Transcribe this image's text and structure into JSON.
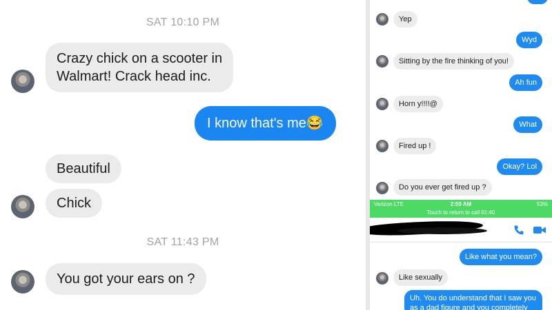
{
  "left": {
    "timestamps": [
      "SAT 10:10 PM",
      "SAT 11:43 PM"
    ],
    "messages": {
      "m1_line1": "Crazy chick on a scooter in",
      "m1_line2": "Walmart!  Crack head inc.",
      "m2": "I know that's me😂",
      "m3": "Beautiful",
      "m4": "Chick",
      "m5": "You got your ears on ?"
    }
  },
  "right": {
    "messages": {
      "yep": "Yep",
      "wyd": "Wyd",
      "sitting": "Sitting by the fire thinking of you!",
      "ahfun": "Ah fun",
      "horny": "Horn y!!!!@",
      "what": "What",
      "firedup": "Fired up !",
      "okay": "Okay? Lol",
      "everfired": "Do you ever get fired up ?",
      "likewhat": "Like what you mean?",
      "likesexually": "Like sexually",
      "understand": "Uh. You do understand that I saw you as a dad figure and you completely"
    },
    "status_bar": {
      "carrier": "Verizon  LTE",
      "time": "2:59 AM",
      "battery": "53%",
      "call_banner": "Touch to return to call 01:40"
    },
    "header_icons": [
      "phone-icon",
      "video-icon"
    ],
    "colors": {
      "outgoing_bubble": "#1f8bf0",
      "incoming_bubble": "#ececec",
      "call_banner": "#4cd964"
    }
  }
}
